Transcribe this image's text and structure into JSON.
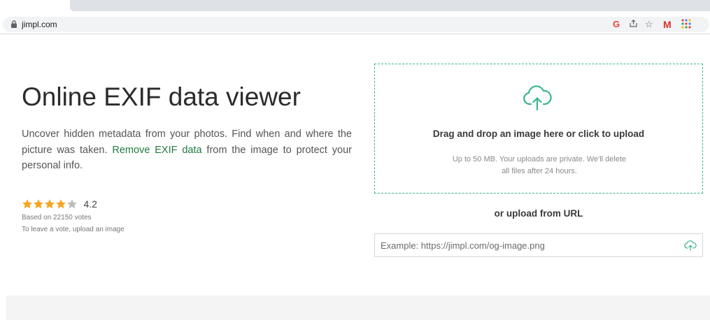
{
  "browser": {
    "url": "jimpl.com",
    "gmail_label": "M"
  },
  "hero": {
    "title": "Online EXIF data viewer",
    "desc_before": "Uncover hidden metadata from your photos. Find when and where the picture was taken. ",
    "desc_link": "Remove EXIF data",
    "desc_after": " from the image to protect your personal info."
  },
  "rating": {
    "value": "4.2",
    "score": 4.2,
    "max": 5,
    "votes": "Based on 22150 votes",
    "hint": "To leave a vote, upload an image",
    "filled_color": "#f5a623",
    "empty_color": "#bdbdbd"
  },
  "upload": {
    "drop_title": "Drag and drop an image here or click to upload",
    "drop_note": "Up to 50 MB. Your uploads are private. We'll delete all files after 24 hours.",
    "url_heading": "or upload from URL",
    "url_placeholder": "Example: https://jimpl.com/og-image.png",
    "url_value": "",
    "accent_color": "#3bb58a"
  },
  "icons": {
    "lock": "lock-icon",
    "google": "google-icon",
    "share": "share-icon",
    "star": "bookmark-star-icon",
    "gmail": "gmail-icon",
    "apps": "apps-grid-icon",
    "upload": "cloud-upload-icon"
  }
}
